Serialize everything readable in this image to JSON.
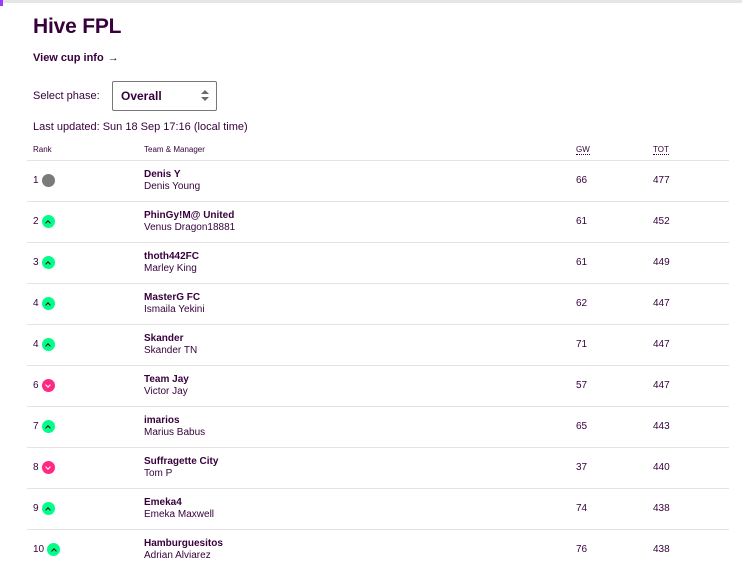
{
  "league": {
    "title": "Hive FPL",
    "cup_link": "View cup info",
    "cup_arrow": "→",
    "phase_label": "Select phase:",
    "phase_selected": "Overall",
    "last_updated": "Last updated: Sun 18 Sep 17:16 (local time)"
  },
  "columns": {
    "rank": "Rank",
    "team": "Team & Manager",
    "gw": "GW",
    "tot": "TOT"
  },
  "colors": {
    "brand": "#37003c",
    "up": "#00ff87",
    "down": "#ff2882",
    "same": "#7a7a7a"
  },
  "rows": [
    {
      "rank": "1",
      "move": "same",
      "team": "Denis Y",
      "manager": "Denis Young",
      "gw": "66",
      "tot": "477"
    },
    {
      "rank": "2",
      "move": "up",
      "team": "PhinGy!M@ United",
      "manager": "Venus Dragon18881",
      "gw": "61",
      "tot": "452"
    },
    {
      "rank": "3",
      "move": "up",
      "team": "thoth442FC",
      "manager": "Marley King",
      "gw": "61",
      "tot": "449"
    },
    {
      "rank": "4",
      "move": "up",
      "team": "MasterG FC",
      "manager": "Ismaila Yekini",
      "gw": "62",
      "tot": "447"
    },
    {
      "rank": "4",
      "move": "up",
      "team": "Skander",
      "manager": "Skander TN",
      "gw": "71",
      "tot": "447"
    },
    {
      "rank": "6",
      "move": "down",
      "team": "Team Jay",
      "manager": "Victor Jay",
      "gw": "57",
      "tot": "447"
    },
    {
      "rank": "7",
      "move": "up",
      "team": "imarios",
      "manager": "Marius Babus",
      "gw": "65",
      "tot": "443"
    },
    {
      "rank": "8",
      "move": "down",
      "team": "Suffragette City",
      "manager": "Tom P",
      "gw": "37",
      "tot": "440"
    },
    {
      "rank": "9",
      "move": "up",
      "team": "Emeka4",
      "manager": "Emeka Maxwell",
      "gw": "74",
      "tot": "438"
    },
    {
      "rank": "10",
      "move": "up",
      "team": "Hamburguesitos",
      "manager": "Adrian Alviarez",
      "gw": "76",
      "tot": "438"
    }
  ]
}
